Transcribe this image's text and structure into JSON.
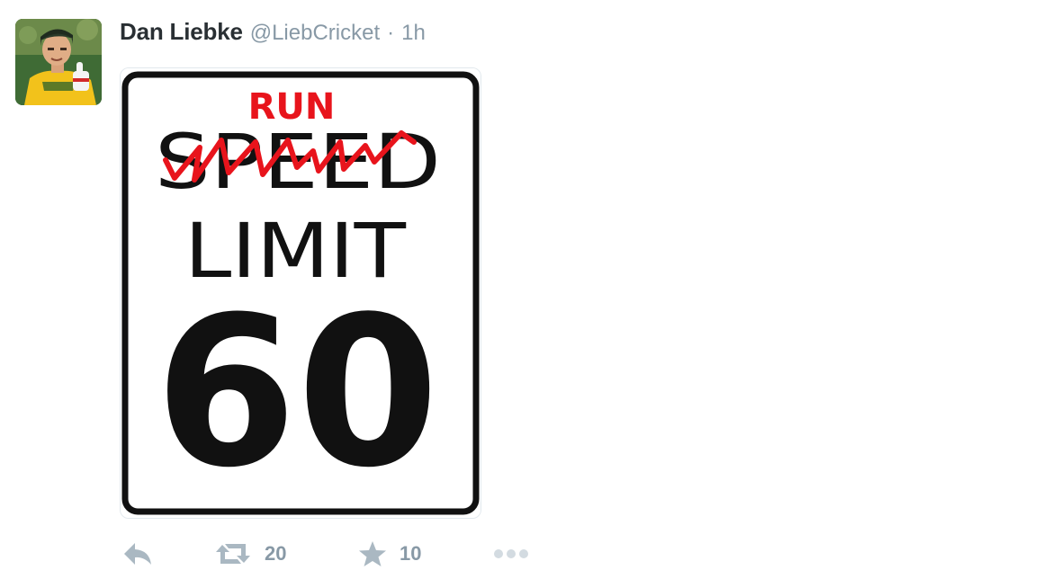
{
  "tweet": {
    "author_name": "Dan Liebke",
    "author_handle": "@LiebCricket",
    "separator": "·",
    "timestamp": "1h",
    "media": {
      "sign_overlay_text": "RUN",
      "sign_struck_text": "SPEED",
      "sign_line2": "LIMIT",
      "sign_number": "60"
    },
    "actions": {
      "reply_icon": "reply-icon",
      "retweet_icon": "retweet-icon",
      "retweet_count": "20",
      "favorite_icon": "star-icon",
      "favorite_count": "10",
      "more_icon": "more-icon"
    }
  },
  "colors": {
    "name": "#292f33",
    "secondary": "#8899a6",
    "action_icon": "#aab8c2",
    "overlay_red": "#e8141c"
  }
}
